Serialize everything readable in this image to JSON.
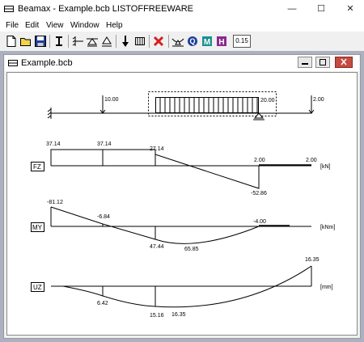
{
  "window": {
    "title": "Beamax - Example.bcb   LISTOFFREEWARE",
    "caption_buttons": {
      "minimize": "—",
      "maximize": "☐",
      "close": "✕"
    }
  },
  "menu": {
    "items": [
      "File",
      "Edit",
      "View",
      "Window",
      "Help"
    ]
  },
  "toolbar": {
    "icons": [
      "new-file-icon",
      "open-file-icon",
      "save-icon",
      "beam-icon",
      "support-fixed-icon",
      "support-pinned-icon",
      "support-roller-icon",
      "point-load-icon",
      "distributed-load-icon",
      "delete-icon",
      "deflection-icon",
      "force-diagram-icon",
      "moment-diagram-icon",
      "displacement-diagram-icon"
    ],
    "factor_value": "0.15"
  },
  "child": {
    "title": "Example.bcb"
  },
  "beam": {
    "loads": {
      "point_left": "10.00",
      "distributed": "20.00",
      "point_right": "2.00"
    }
  },
  "fz": {
    "label": "FZ",
    "unit": "[kN]",
    "values": [
      "37.14",
      "37.14",
      "27.14",
      "2.00",
      "2.00",
      "-52.86"
    ]
  },
  "my": {
    "label": "MY",
    "unit": "[kNm]",
    "values": [
      "-81.12",
      "-6.84",
      "47.44",
      "65.85",
      "-4.00"
    ]
  },
  "uz": {
    "label": "UZ",
    "unit": "[mm]",
    "values": [
      "16.35",
      "6.42",
      "15.16",
      "16.35"
    ]
  }
}
